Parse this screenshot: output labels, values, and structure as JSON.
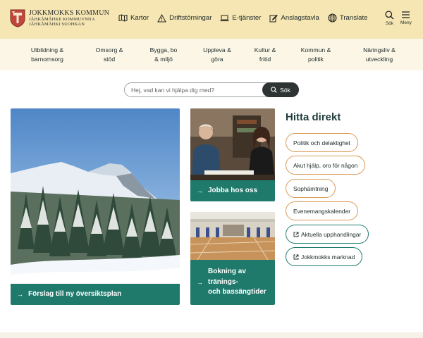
{
  "colors": {
    "header_bg": "#f5e6b3",
    "nav_bg": "#fbf6e6",
    "accent": "#1f7a6c",
    "pill_orange": "#d99a55",
    "title": "#1e3c3a"
  },
  "header": {
    "logo_main": "JOKKMOKKS KOMMUN",
    "logo_sub1": "JÅHKÅMÅHKE KOMMUVNNA",
    "logo_sub2": "JÅHKÅMÅHKI SUOHKAN",
    "links": [
      {
        "label": "Kartor",
        "icon": "map-icon"
      },
      {
        "label": "Driftstörningar",
        "icon": "warning-icon"
      },
      {
        "label": "E-tjänster",
        "icon": "laptop-icon"
      },
      {
        "label": "Anslagstavla",
        "icon": "edit-icon"
      },
      {
        "label": "Translate",
        "icon": "globe-icon"
      }
    ],
    "search_label": "Sök",
    "menu_label": "Meny"
  },
  "nav": [
    "Utbildning &\nbarnomsorg",
    "Omsorg &\nstöd",
    "Bygga, bo\n& miljö",
    "Uppleva &\ngöra",
    "Kultur &\nfritid",
    "Kommun &\npolitik",
    "Näringsliv &\nutveckling"
  ],
  "search": {
    "placeholder": "Hej, vad kan vi hjälpa dig med?",
    "button": "Sök"
  },
  "cards": [
    {
      "label": "Förslag till ny översiktsplan"
    },
    {
      "label": "Jobba hos oss"
    },
    {
      "label": "Bokning av\ntränings-\noch bassängtider"
    }
  ],
  "hitta_direkt": {
    "title": "Hitta direkt",
    "links": [
      {
        "label": "Politik och delaktighet",
        "style": "orange",
        "external": false
      },
      {
        "label": "Akut hjälp, oro för någon",
        "style": "orange",
        "external": false
      },
      {
        "label": "Sophämtning",
        "style": "orange",
        "external": false
      },
      {
        "label": "Evenemangskalender",
        "style": "orange",
        "external": false
      },
      {
        "label": "Aktuella upphandlingar",
        "style": "teal",
        "external": true
      },
      {
        "label": "Jokkmokks marknad",
        "style": "teal",
        "external": true
      }
    ]
  }
}
